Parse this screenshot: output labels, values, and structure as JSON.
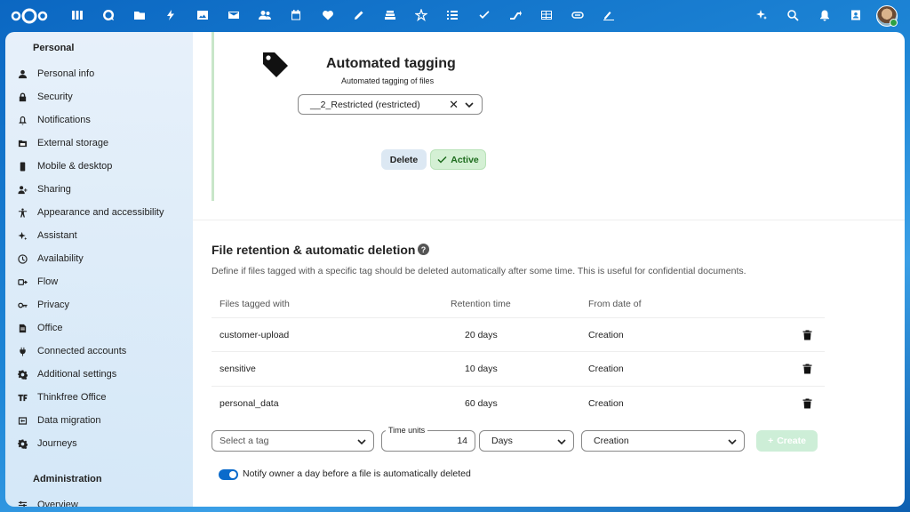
{
  "colors": {
    "accent": "#0b6bcb",
    "header": "#0b67c2",
    "active_green": "#d4f0d4",
    "create_disabled": "#cdeed7"
  },
  "header": {
    "apps": [
      "dashboard-icon",
      "talk-icon",
      "files-icon",
      "activity-icon",
      "photos-icon",
      "mail-icon",
      "contacts-icon",
      "calendar-icon",
      "favorites-icon",
      "notes-icon",
      "deck-icon",
      "news-icon",
      "tasks-icon",
      "checklist-icon",
      "flow-icon",
      "tables-icon",
      "tag-icon",
      "signature-icon"
    ],
    "right": [
      "assistant-icon",
      "search-icon",
      "notifications-icon",
      "contacts-menu-icon"
    ]
  },
  "sidebar": {
    "personal_title": "Personal",
    "items": [
      {
        "label": "Personal info",
        "icon": "user-icon"
      },
      {
        "label": "Security",
        "icon": "lock-icon"
      },
      {
        "label": "Notifications",
        "icon": "bell-icon"
      },
      {
        "label": "External storage",
        "icon": "storage-icon"
      },
      {
        "label": "Mobile & desktop",
        "icon": "phone-icon"
      },
      {
        "label": "Sharing",
        "icon": "share-icon"
      },
      {
        "label": "Appearance and accessibility",
        "icon": "accessibility-icon"
      },
      {
        "label": "Assistant",
        "icon": "sparkle-icon"
      },
      {
        "label": "Availability",
        "icon": "clock-icon"
      },
      {
        "label": "Flow",
        "icon": "flow-icon"
      },
      {
        "label": "Privacy",
        "icon": "key-icon"
      },
      {
        "label": "Office",
        "icon": "office-icon"
      },
      {
        "label": "Connected accounts",
        "icon": "plug-icon"
      },
      {
        "label": "Additional settings",
        "icon": "gear-icon"
      },
      {
        "label": "Thinkfree Office",
        "icon": "thinkfree-icon"
      },
      {
        "label": "Data migration",
        "icon": "migration-icon"
      },
      {
        "label": "Journeys",
        "icon": "gear-icon"
      }
    ],
    "admin_title": "Administration",
    "admin_items": [
      {
        "label": "Overview",
        "icon": "sliders-icon"
      }
    ]
  },
  "tagging": {
    "title": "Automated tagging",
    "subtitle": "Automated tagging of files",
    "selected_tag": "__2_Restricted (restricted)",
    "delete_label": "Delete",
    "active_label": "Active"
  },
  "retention": {
    "title": "File retention & automatic deletion",
    "help": "?",
    "description": "Define if files tagged with a specific tag should be deleted automatically after some time. This is useful for confidential documents.",
    "columns": [
      "Files tagged with",
      "Retention time",
      "From date of"
    ],
    "rows": [
      {
        "tag": "customer-upload",
        "time": "20 days",
        "from": "Creation"
      },
      {
        "tag": "sensitive",
        "time": "10 days",
        "from": "Creation"
      },
      {
        "tag": "personal_data",
        "time": "60 days",
        "from": "Creation"
      }
    ],
    "new_rule": {
      "tag_placeholder": "Select a tag",
      "time_units_label": "Time units",
      "time_units_value": "14",
      "unit": "Days",
      "from": "Creation",
      "create_label": "Create"
    },
    "notify_label": "Notify owner a day before a file is automatically deleted",
    "notify_enabled": true
  }
}
